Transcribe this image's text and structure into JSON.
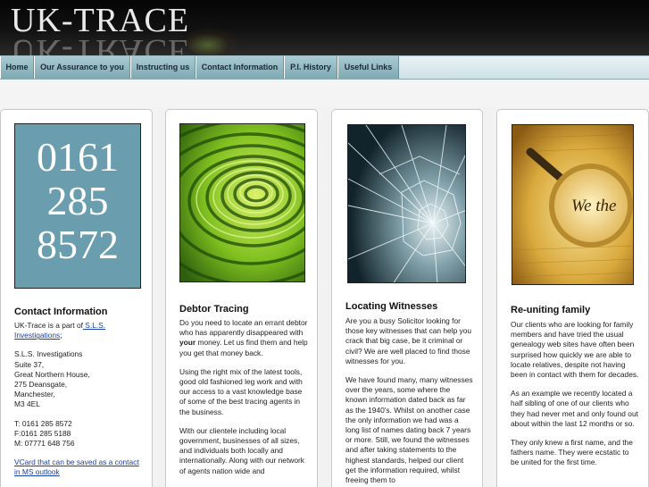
{
  "header": {
    "logo": "UK-TRACE"
  },
  "nav": {
    "items": [
      "Home",
      "Our Assurance to you",
      "Instructing us",
      "Contact Information",
      "P.I. History",
      "Useful Links"
    ]
  },
  "cards": [
    {
      "title": "Contact Information",
      "phone_lines": [
        "0161",
        "285",
        "8572"
      ],
      "intro_text": "UK-Trace is a part of",
      "intro_link": " S.L.S. Investigations",
      "intro_end": ";",
      "address": [
        "S.L.S. Investigations",
        "Suite 37,",
        "Great Northern House,",
        "275 Deansgate,",
        "Manchester,",
        "M3 4EL"
      ],
      "phones": [
        "T: 0161 285 8572",
        "F:0161 285 5188",
        "M: 07771 648 756"
      ],
      "vcard_link": "VCard that can be saved as a contact in MS outlook"
    },
    {
      "title": "Debtor Tracing",
      "image_icon": "maze-image",
      "p1_before": "Do you need to locate an errant debtor who has apparently disappeared with ",
      "p1_bold": "your",
      "p1_after": " money. Let us find them and help you get that money back.",
      "p2": "Using the right mix of the latest tools, good old fashioned leg work and with our access to a vast knowledge base of some of the best tracing agents in the business.",
      "p3": "With our clientele including local government, businesses of all sizes, and individuals both locally and internationally. Along with our network of agents nation wide and"
    },
    {
      "title": "Locating Witnesses",
      "image_icon": "broken-glass-image",
      "p1": "Are you a busy Solicitor looking for those key witnesses that can help you crack that big case, be it criminal or civil? We are well placed to find those witnesses for you.",
      "p2": "We have found many, many witnesses over the years, some where the known information dated back as far as the 1940's. Whilst on another case the only information we had was a long list of names dating back 7 years or more. Still, we found the witnesses and after taking statements to the highest standards, helped our client get the information required, whilst freeing them to"
    },
    {
      "title": "Re-uniting family",
      "image_icon": "magnifying-glass-image",
      "image_text": "We the",
      "p1": "Our clients who are looking for family members and have tried the usual genealogy web sites have often been surprised how quickly we are able to locate relatives, despite not having been in contact with them for decades.",
      "p2": "As an example we recently located a half sibling of one of our clients who they had never met and only found out about within the last 12 months or so.",
      "p3": "They only knew a first name, and the fathers name. They were ecstatic to be united for the first time."
    }
  ]
}
